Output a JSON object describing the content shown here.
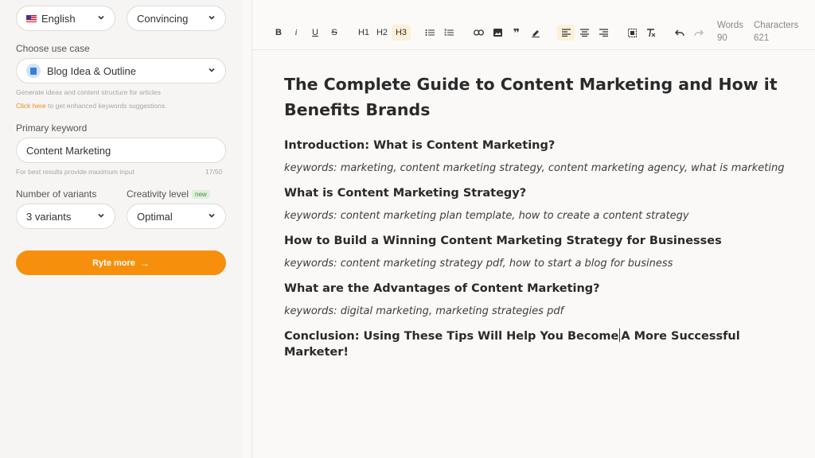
{
  "sidebar": {
    "language": "English",
    "tone": "Convincing",
    "use_case_label": "Choose use case",
    "use_case": "Blog Idea & Outline",
    "use_case_hint": "Generate ideas and content structure for articles",
    "click_here": "Click here",
    "click_here_suffix": "to get enhanced keywords suggestions.",
    "primary_keyword_label": "Primary keyword",
    "primary_keyword_value": "Content Marketing",
    "keyword_hint": "For best results provide maximum input",
    "keyword_count": "17/50",
    "variants_label": "Number of variants",
    "variants_value": "3 variants",
    "creativity_label": "Creativity level",
    "new_badge": "new",
    "creativity_value": "Optimal",
    "ryte_button": "Ryte more"
  },
  "toolbar": {
    "bold": "B",
    "italic": "i",
    "underline": "U",
    "strike": "S",
    "h1": "H1",
    "h2": "H2",
    "h3": "H3",
    "words_label": "Words",
    "words_value": "90",
    "chars_label": "Characters",
    "chars_value": "621"
  },
  "document": {
    "title": "The Complete Guide to Content Marketing and How it Benefits Brands",
    "sections": [
      {
        "heading": "Introduction: What is Content Marketing?",
        "keywords": "keywords: marketing, content marketing strategy, content marketing agency, what is marketing"
      },
      {
        "heading": "What is Content Marketing Strategy?",
        "keywords": "keywords: content marketing plan template, how to create a content strategy"
      },
      {
        "heading": "How to Build a Winning Content Marketing Strategy for Businesses",
        "keywords": "keywords: content marketing strategy pdf, how to start a blog for business"
      },
      {
        "heading": "What are the Advantages of Content Marketing?",
        "keywords": "keywords: digital marketing, marketing strategies pdf"
      }
    ],
    "conclusion_part1": "Conclusion: Using These Tips Will Help You Become",
    "conclusion_part2": "A More Successful Marketer!"
  }
}
